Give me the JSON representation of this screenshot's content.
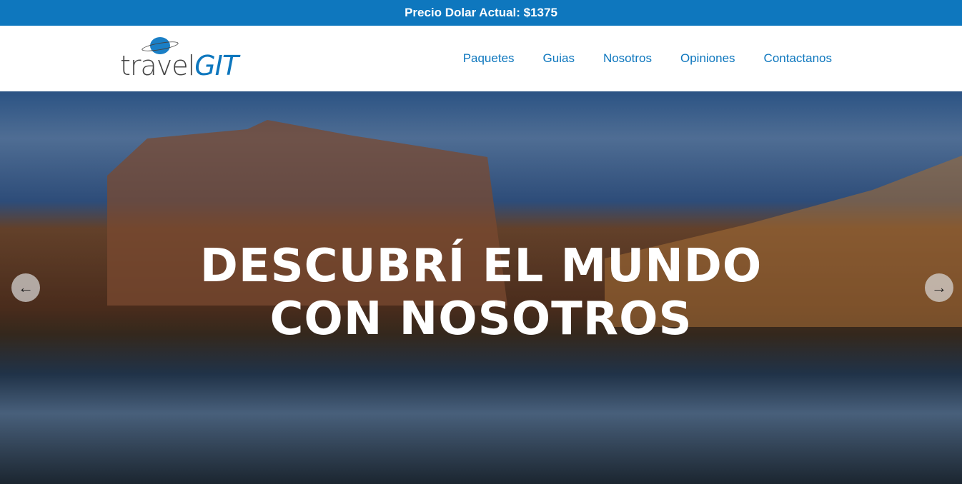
{
  "topbar": {
    "text": "Precio Dolar Actual: $1375"
  },
  "logo": {
    "part1": "travel",
    "part2": "GIT"
  },
  "nav": [
    "Paquetes",
    "Guias",
    "Nosotros",
    "Opiniones",
    "Contactanos"
  ],
  "hero": {
    "line1": "DESCUBRÍ EL MUNDO",
    "line2": "CON NOSOTROS",
    "prev_icon": "←",
    "next_icon": "→"
  }
}
